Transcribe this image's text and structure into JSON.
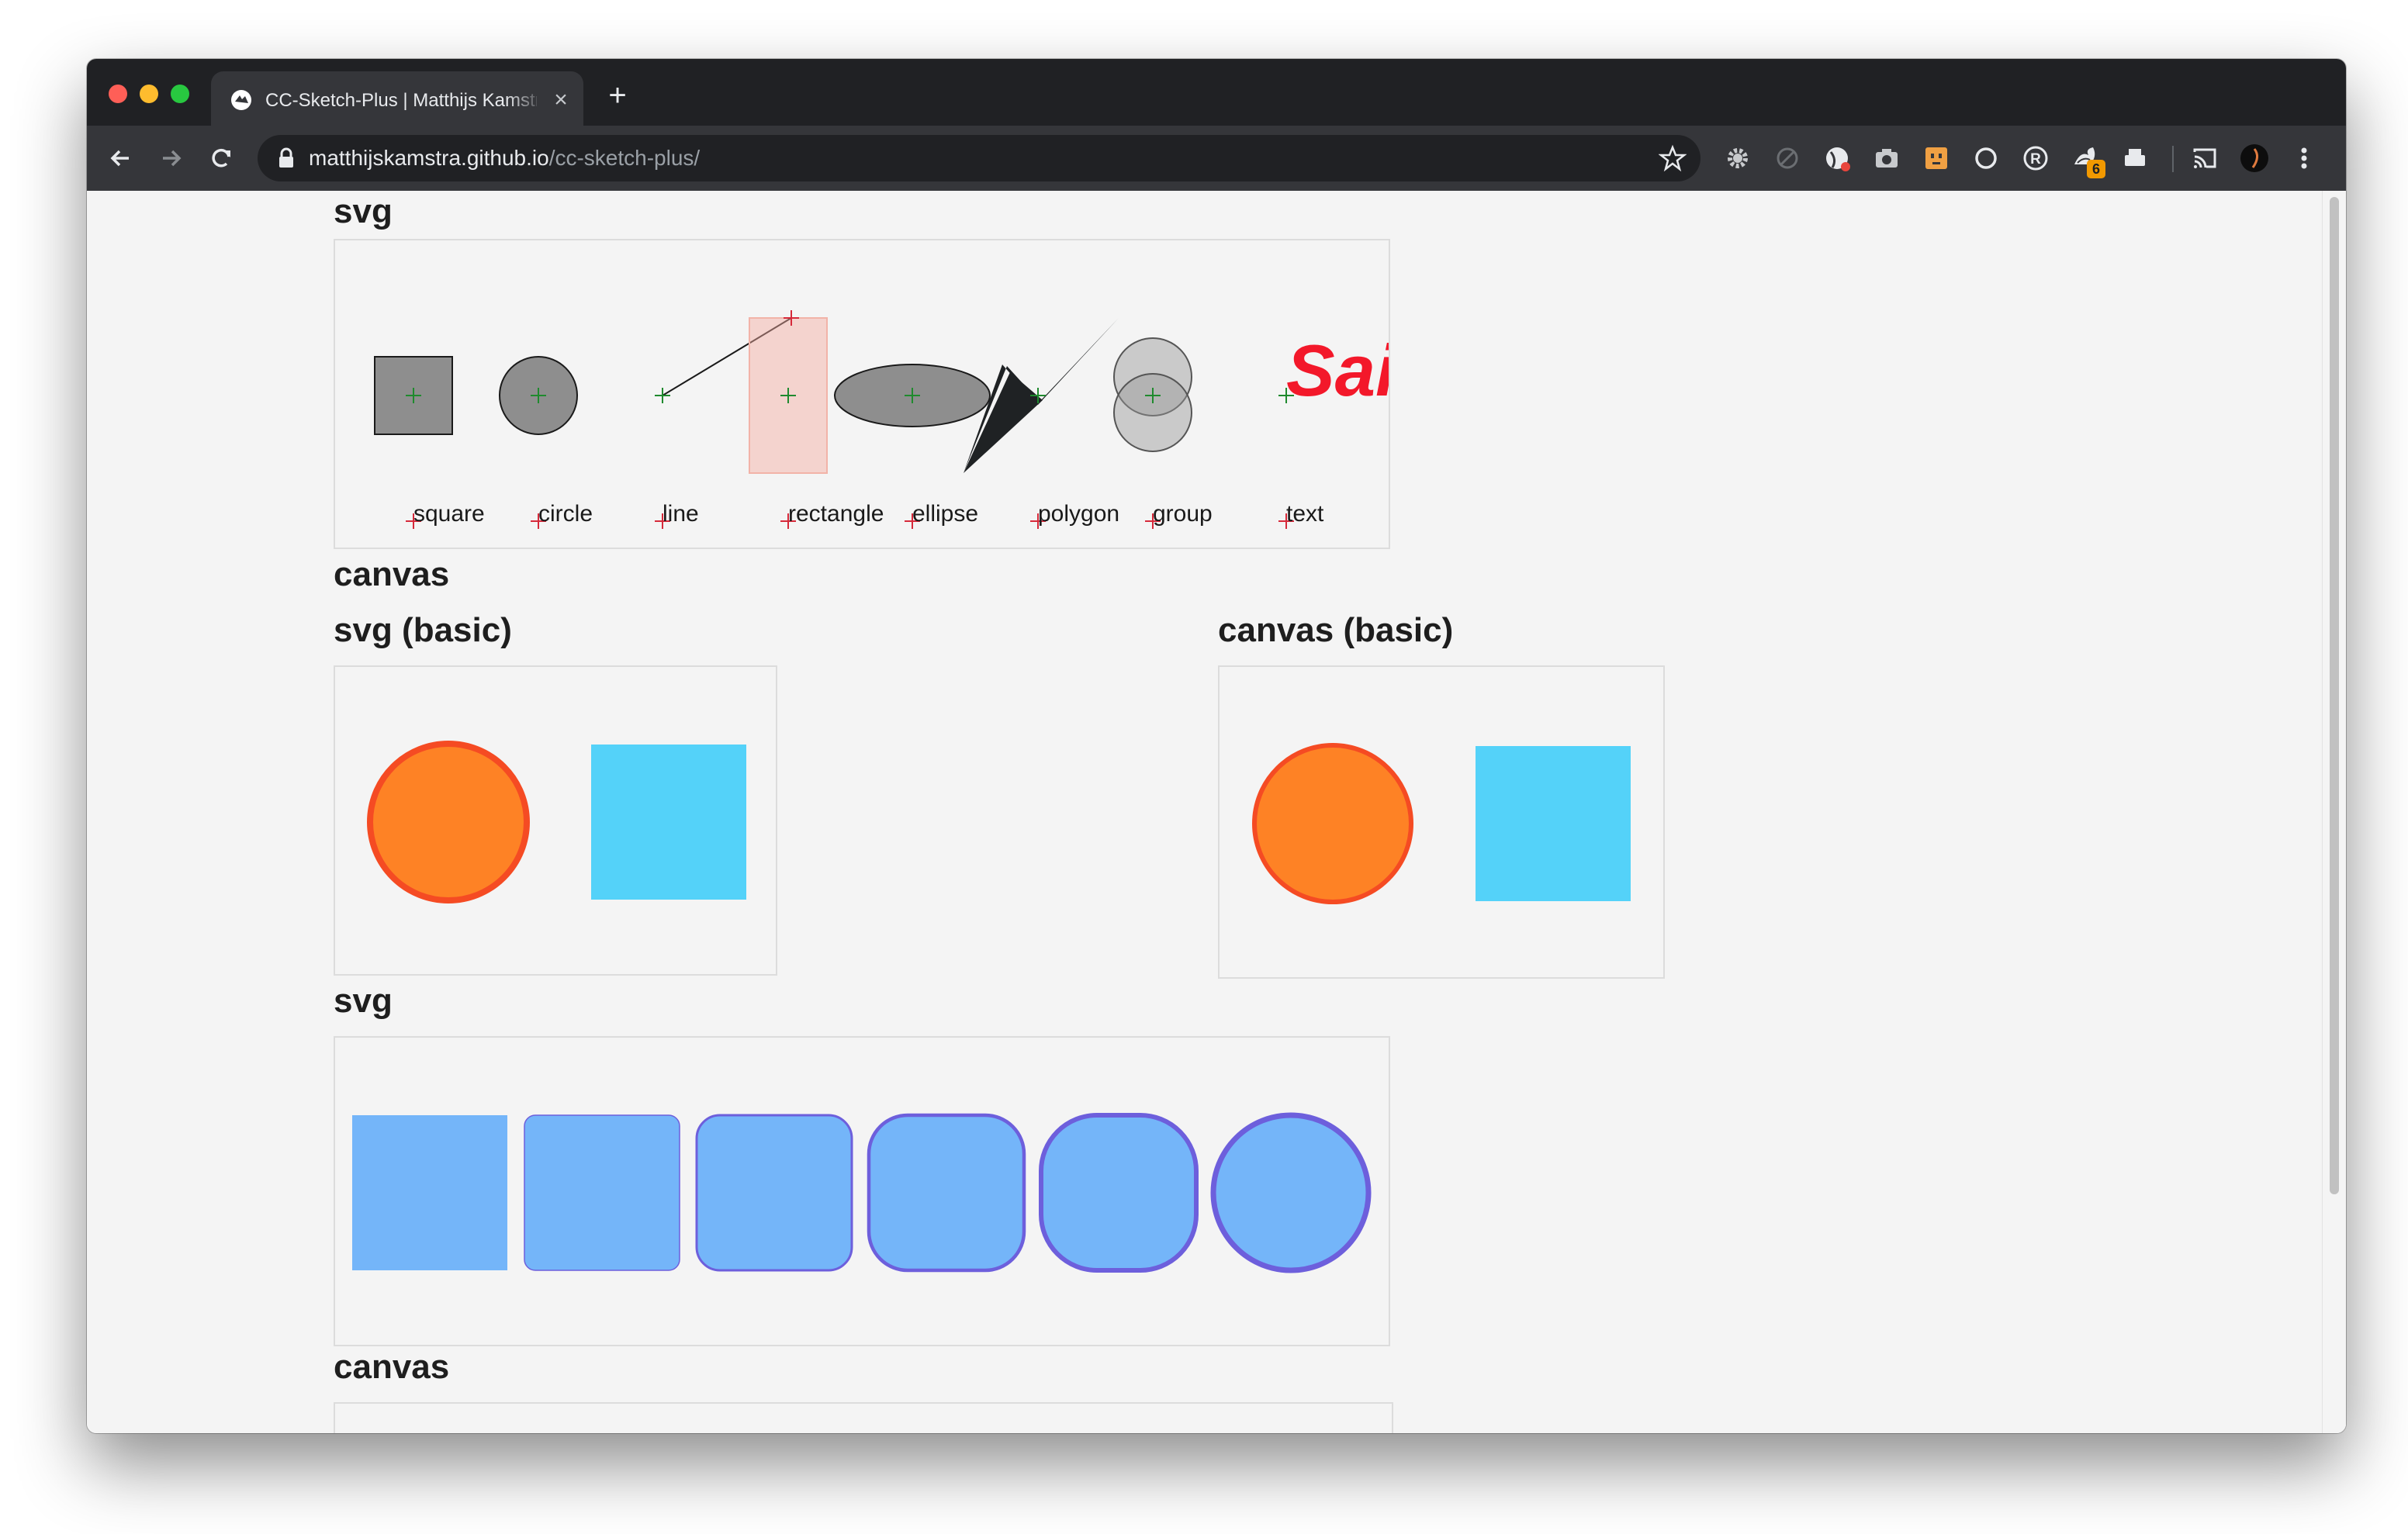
{
  "browser": {
    "tab_title": "CC-Sketch-Plus | Matthijs Kamstra",
    "url_host": "matthijskamstra.github.io",
    "url_path": "/cc-sketch-plus/",
    "extension_badge": "6"
  },
  "sections": {
    "svg_top": "svg",
    "canvas_top": "canvas",
    "svg_basic": "svg (basic)",
    "canvas_basic": "canvas (basic)",
    "svg_rounded": "svg",
    "canvas_bottom": "canvas"
  },
  "shape_labels": [
    "square",
    "circle",
    "line",
    "rectangle",
    "ellipse",
    "polygon",
    "group",
    "text"
  ],
  "text_sample": "Sai",
  "colors": {
    "orange_fill": "#fe8225",
    "orange_stroke": "#f54b23",
    "cyan_fill": "#54d2f9",
    "blue_fill": "#74b5f9",
    "purple_stroke": "#6d5fdc",
    "text_red": "#f3182a"
  }
}
